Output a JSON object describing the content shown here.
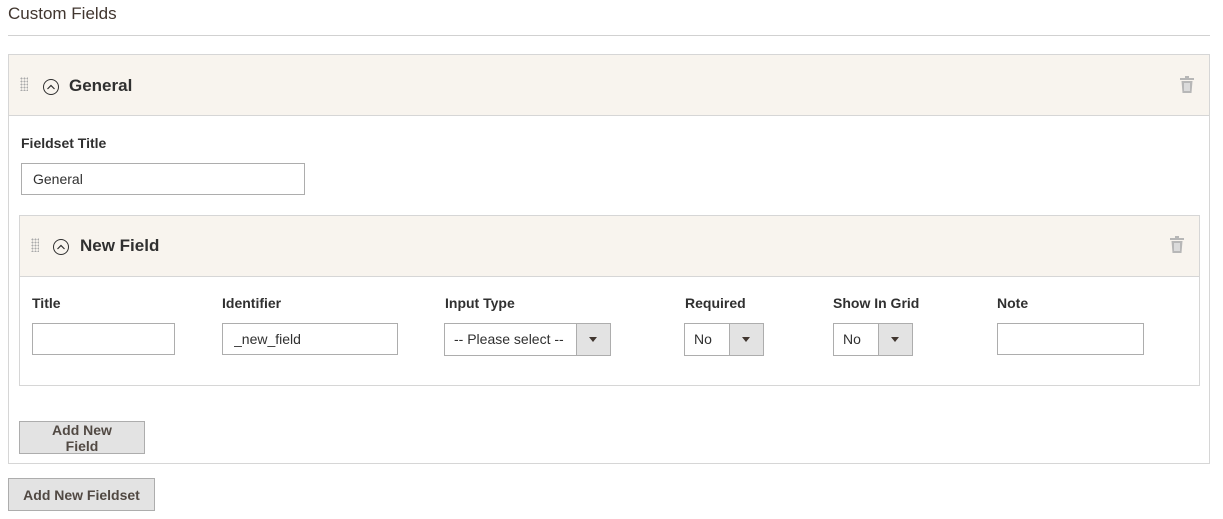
{
  "section": {
    "title": "Custom Fields"
  },
  "fieldset": {
    "title": "General",
    "title_label": "Fieldset Title",
    "title_value": "General",
    "add_field_label": "Add New Field"
  },
  "field": {
    "header": "New Field",
    "columns": {
      "title": "Title",
      "identifier": "Identifier",
      "input_type": "Input Type",
      "required": "Required",
      "show_in_grid": "Show In Grid",
      "note": "Note"
    },
    "values": {
      "title": "",
      "identifier": "_new_field",
      "input_type": "-- Please select --",
      "required": "No",
      "show_in_grid": "No",
      "note": ""
    }
  },
  "add_fieldset_label": "Add New Fieldset",
  "icons": {
    "drag": "drag-handle-icon",
    "collapse": "chevron-up-circle-icon",
    "delete": "trash-icon"
  }
}
